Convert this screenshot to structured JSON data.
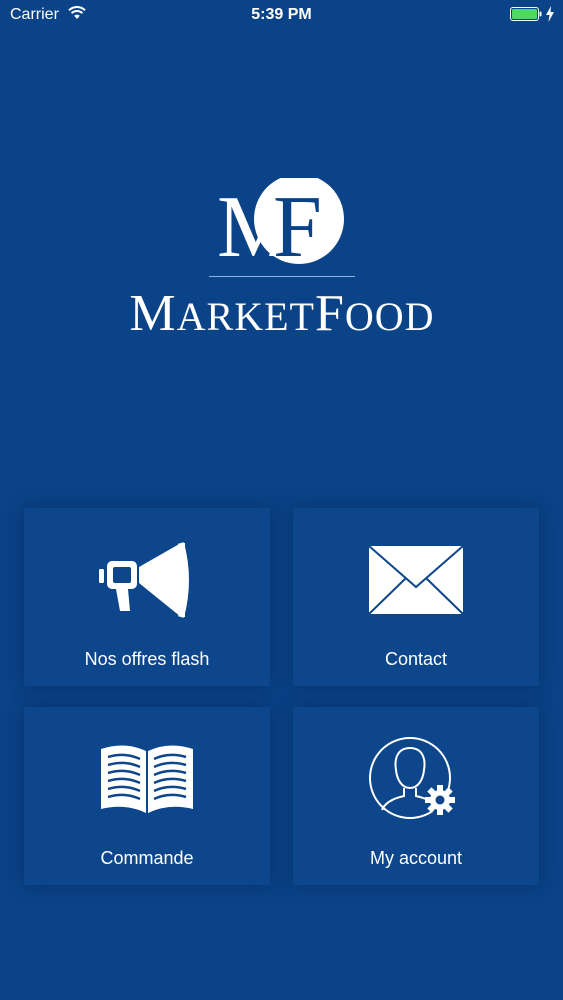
{
  "status_bar": {
    "carrier": "Carrier",
    "time": "5:39 PM",
    "battery_color": "#4cd964"
  },
  "logo": {
    "monogram_left": "M",
    "monogram_right": "F",
    "name_parts": [
      "M",
      "ARKET",
      "F",
      "OOD"
    ]
  },
  "tiles": [
    {
      "label": "Nos offres flash",
      "icon": "megaphone-icon"
    },
    {
      "label": "Contact",
      "icon": "envelope-icon"
    },
    {
      "label": "Commande",
      "icon": "open-book-icon"
    },
    {
      "label": "My account",
      "icon": "user-settings-icon"
    }
  ],
  "colors": {
    "background": "#0a4387",
    "tile": "#0d468b",
    "text": "#ffffff"
  }
}
